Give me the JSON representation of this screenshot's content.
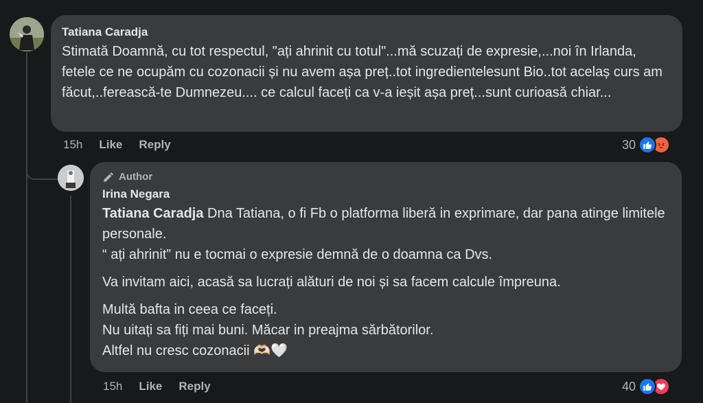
{
  "comment": {
    "author": "Tatiana Caradja",
    "text": "Stimată Doamnă, cu tot respectul, \"ați ahrinit cu totul\"...mă scuzați de expresie,...noi în Irlanda, fetele ce ne ocupăm cu cozonacii și nu avem așa preț..tot ingredientelesunt Bio..tot acelaș curs am făcut,..ferească-te Dumnezeu.... ce calcul faceți ca v-a ieșit așa preț...sunt curioasă chiar...",
    "time": "15h",
    "like_label": "Like",
    "reply_label": "Reply",
    "reaction_count": "30",
    "reactions": [
      "like-icon",
      "angry-icon"
    ]
  },
  "reply": {
    "badge": "Author",
    "author": "Irina Negara",
    "mention": "Tatiana Caradja",
    "para1_rest": " Dna Tatiana, o fi Fb o platforma liberă in exprimare, dar pana atinge limitele personale.",
    "para1_line2": "“ ați ahrinit” nu e tocmai o expresie demnă de o doamna ca Dvs.",
    "para2": "Va invitam aici, acasă sa lucrați alături de noi și sa facem calcule împreuna.",
    "para3_line1": "Multă bafta in ceea ce faceți.",
    "para3_line2": "Nu uitați sa fiți mai buni. Măcar in preajma sărbătorilor.",
    "para3_line3": "Altfel nu cresc cozonacii 🫶🏻🤍",
    "time": "15h",
    "like_label": "Like",
    "reply_label": "Reply",
    "reaction_count": "40",
    "reactions": [
      "like-icon",
      "love-icon"
    ]
  },
  "colors": {
    "background": "#18191a",
    "bubble": "#3a3b3c",
    "text": "#e4e6eb",
    "secondary": "#b0b3b8",
    "like": "#1877f2",
    "angry": "#f0633f",
    "love": "#f33e58"
  }
}
